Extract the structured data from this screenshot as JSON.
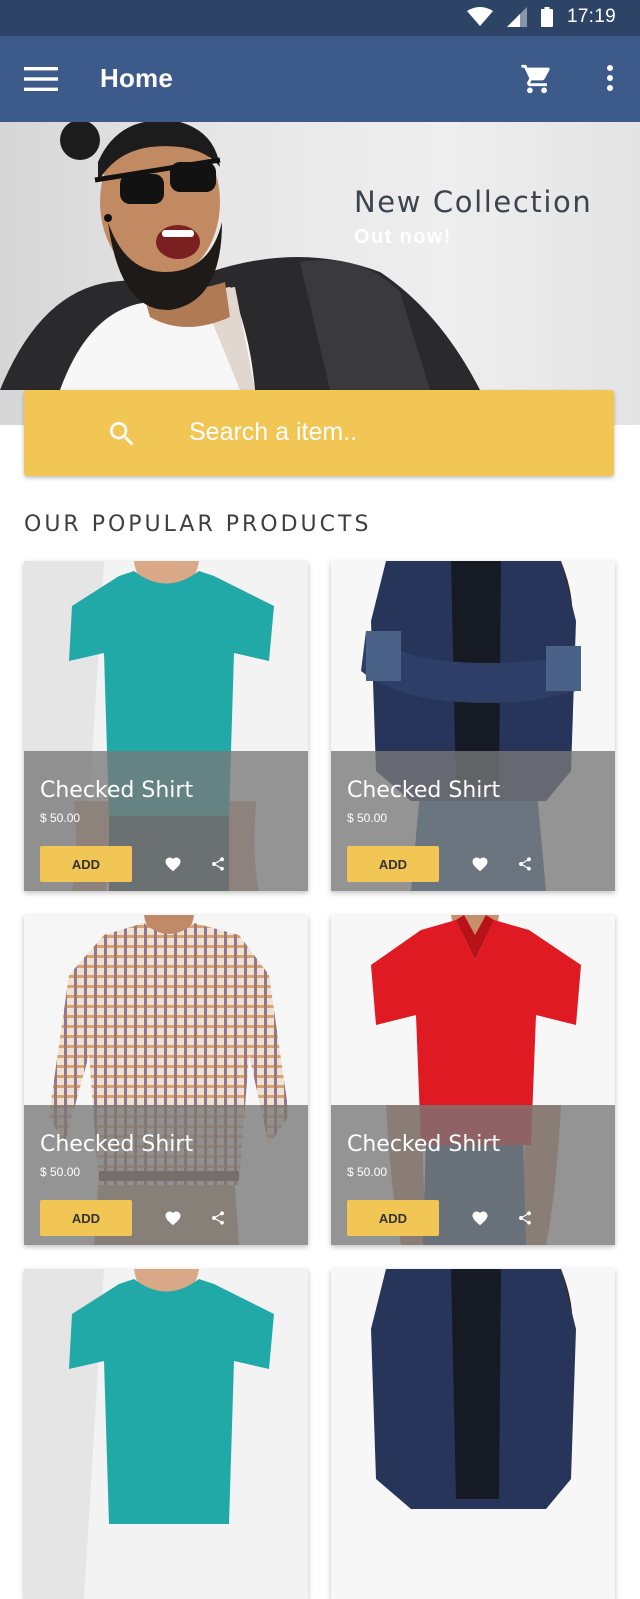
{
  "status": {
    "time": "17:19"
  },
  "appbar": {
    "title": "Home"
  },
  "hero": {
    "headline": "New Collection",
    "subline": "Out now!"
  },
  "search": {
    "placeholder": "Search a item.."
  },
  "section": {
    "title": "OUR POPULAR PRODUCTS"
  },
  "products": [
    {
      "name": "Checked Shirt",
      "price": "$ 50.00",
      "add_label": "ADD",
      "image": "teal-tshirt"
    },
    {
      "name": "Checked Shirt",
      "price": "$ 50.00",
      "add_label": "ADD",
      "image": "denim-shirt"
    },
    {
      "name": "Checked Shirt",
      "price": "$ 50.00",
      "add_label": "ADD",
      "image": "checked-shirt"
    },
    {
      "name": "Checked Shirt",
      "price": "$ 50.00",
      "add_label": "ADD",
      "image": "red-polo"
    },
    {
      "name": "",
      "price": "",
      "add_label": "",
      "image": "teal-tshirt"
    },
    {
      "name": "",
      "price": "",
      "add_label": "",
      "image": "denim-shirt"
    }
  ],
  "colors": {
    "statusbar": "#2e4466",
    "appbar": "#3c5a8a",
    "accent": "#f2c655"
  },
  "icons": [
    "menu-icon",
    "cart-icon",
    "more-vert-icon",
    "search-icon",
    "heart-icon",
    "share-icon",
    "wifi-icon",
    "signal-icon",
    "battery-icon"
  ]
}
